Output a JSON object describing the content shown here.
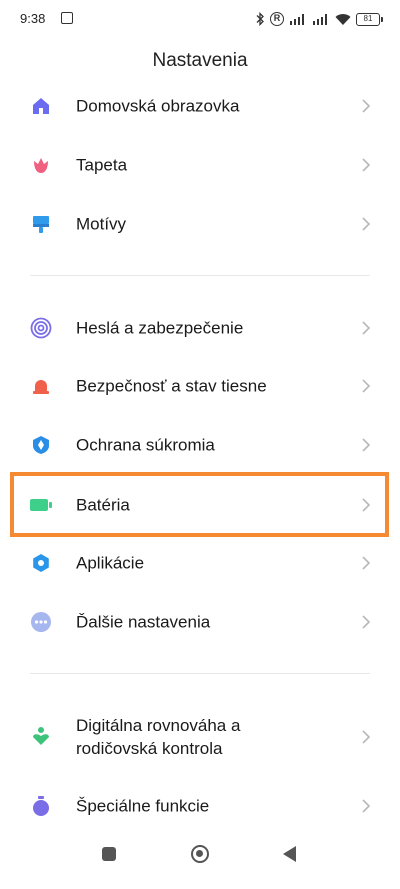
{
  "status_bar": {
    "time": "9:38",
    "battery_level": "81"
  },
  "header": {
    "title": "Nastavenia"
  },
  "settings": [
    {
      "label": "Domovská obrazovka",
      "icon": "home-icon",
      "color": "#6b6cf0"
    },
    {
      "label": "Tapeta",
      "icon": "wallpaper-flower-icon",
      "color": "#f06080"
    },
    {
      "label": "Motívy",
      "icon": "themes-brush-icon",
      "color": "#2f9bea"
    },
    {
      "label": "Heslá a zabezpečenie",
      "icon": "fingerprint-icon",
      "color": "#7a6de6"
    },
    {
      "label": "Bezpečnosť a stav tiesne",
      "icon": "emergency-alarm-icon",
      "color": "#f0604a"
    },
    {
      "label": "Ochrana súkromia",
      "icon": "privacy-shield-icon",
      "color": "#2a8de6"
    },
    {
      "label": "Batéria",
      "icon": "battery-icon",
      "color": "#3ed08a"
    },
    {
      "label": "Aplikácie",
      "icon": "apps-gear-icon",
      "color": "#2a96ea"
    },
    {
      "label": "Ďalšie nastavenia",
      "icon": "more-dots-icon",
      "color": "#a6b6ee"
    },
    {
      "label": "Digitálna rovnováha a\nrodičovská kontrola",
      "icon": "digital-wellbeing-icon",
      "color": "#3ec47a"
    },
    {
      "label": "Špeciálne funkcie",
      "icon": "special-features-icon",
      "color": "#7a6de6"
    }
  ],
  "highlight_color": "#f58a33"
}
